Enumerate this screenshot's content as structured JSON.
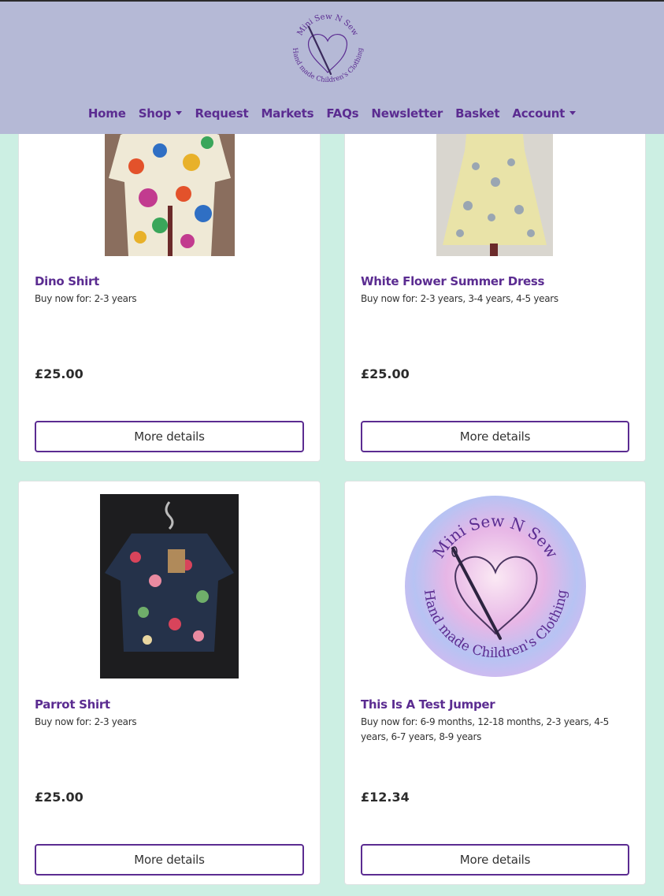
{
  "header": {
    "logo_top_text": "Mini Sew N Sew",
    "logo_bottom_text": "Hand made Children's Clothing"
  },
  "nav": {
    "home": "Home",
    "shop": "Shop",
    "request": "Request",
    "markets": "Markets",
    "faqs": "FAQs",
    "newsletter": "Newsletter",
    "basket": "Basket",
    "account": "Account"
  },
  "products": [
    {
      "name": "Dino Shirt",
      "sizes": "Buy now for: 2-3 years",
      "price": "£25.00",
      "button": "More details"
    },
    {
      "name": "White Flower Summer Dress",
      "sizes": "Buy now for: 2-3 years, 3-4 years, 4-5 years",
      "price": "£25.00",
      "button": "More details"
    },
    {
      "name": "Parrot Shirt",
      "sizes": "Buy now for: 2-3 years",
      "price": "£25.00",
      "button": "More details"
    },
    {
      "name": "This Is A Test Jumper",
      "sizes": "Buy now for: 6-9 months, 12-18 months, 2-3 years, 4-5 years, 6-7 years, 8-9 years",
      "price": "£12.34",
      "button": "More details"
    }
  ],
  "colors": {
    "brand_purple": "#5b2c91",
    "header_bg": "#b5b9d6",
    "page_bg": "#ccefe3"
  }
}
